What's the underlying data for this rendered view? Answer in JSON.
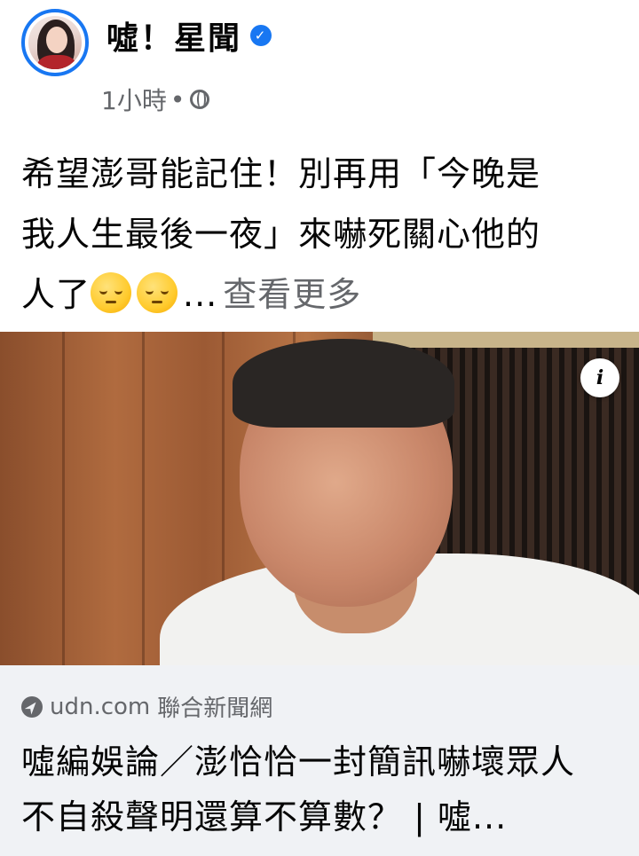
{
  "post": {
    "page_name": "噓！星聞",
    "time": "1小時",
    "separator": "•",
    "text_lines": [
      "希望澎哥能記住！別再用「今晚是",
      "我人生最後一夜」來嚇死關心他的",
      "人了"
    ],
    "ellipsis": "...",
    "see_more": "查看更多",
    "emojis": [
      "pensive-face-icon",
      "pensive-face-icon"
    ]
  },
  "link": {
    "domain": "udn.com",
    "source": "聯合新聞網",
    "title": "噓編娛論／澎恰恰一封簡訊嚇壞眾人 不自殺聲明還算不算數？ | 噓..."
  },
  "colors": {
    "accent": "#1877f2",
    "secondary_text": "#65676b",
    "link_card_bg": "#f0f2f5"
  }
}
